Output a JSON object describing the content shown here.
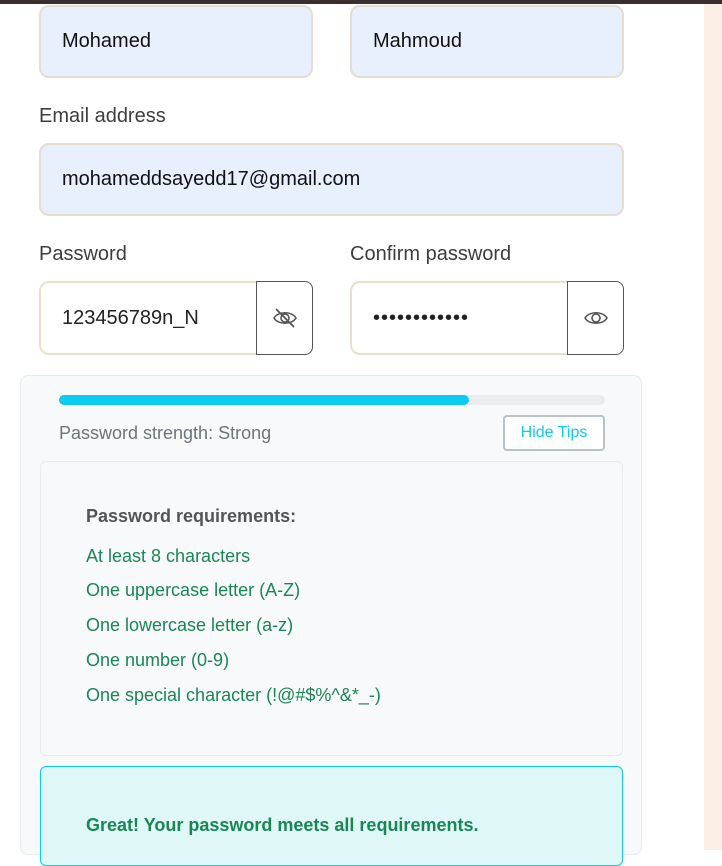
{
  "form": {
    "first_name": "Mohamed",
    "last_name": "Mahmoud",
    "email_label": "Email address",
    "email_value": "mohameddsayedd17@gmail.com",
    "password_label": "Password",
    "password_value": "123456789n_N",
    "password_toggle_icon": "eye-slash-icon",
    "confirm_label": "Confirm password",
    "confirm_value": "••••••••••••",
    "confirm_toggle_icon": "eye-icon"
  },
  "strength": {
    "level_fraction": 0.75,
    "bar_color": "#0dcaf0",
    "text": "Password strength: Strong",
    "hide_tips_label": "Hide Tips"
  },
  "requirements": {
    "title": "Password requirements:",
    "items": [
      "At least 8 characters",
      "One uppercase letter (A-Z)",
      "One lowercase letter (a-z)",
      "One number (0-9)",
      "One special character (!@#$%^&*_-)"
    ],
    "met_color": "#198754"
  },
  "success": {
    "message": "Great! Your password meets all requirements."
  }
}
